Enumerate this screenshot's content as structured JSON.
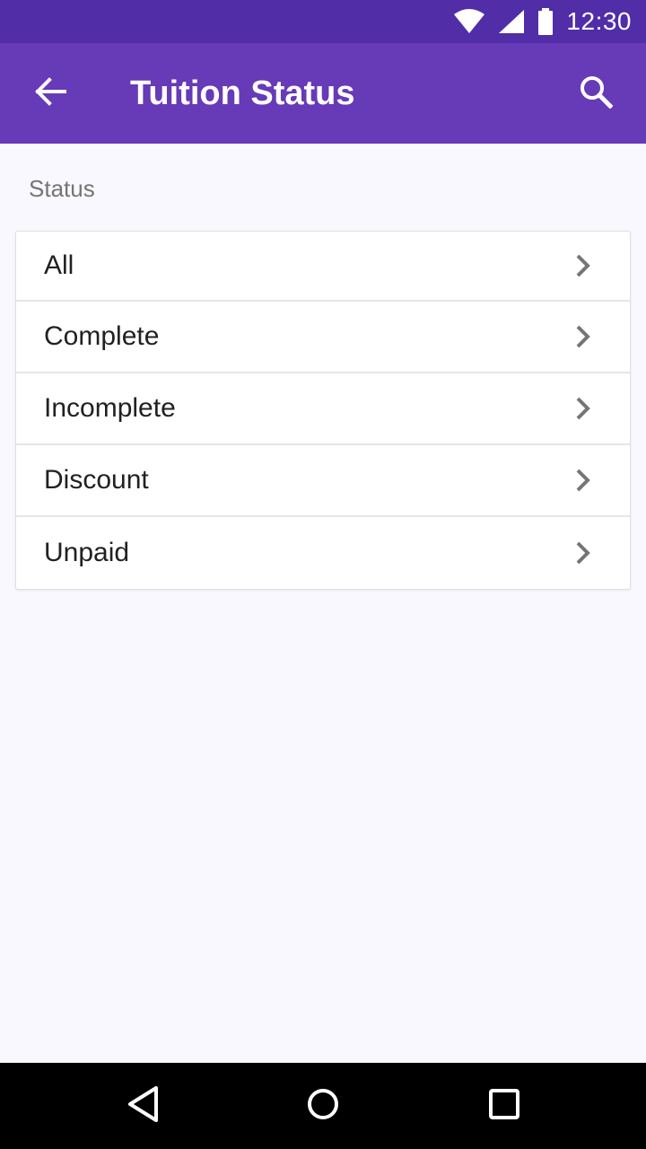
{
  "status_bar": {
    "time": "12:30",
    "icons": [
      "wifi-icon",
      "cell-signal-icon",
      "battery-icon"
    ]
  },
  "app_bar": {
    "title": "Tuition Status",
    "back_icon": "arrow-left-icon",
    "search_icon": "search-icon",
    "color": "#673ab7",
    "status_bar_color": "#512da8"
  },
  "section": {
    "header": "Status"
  },
  "status_list": {
    "items": [
      {
        "label": "All"
      },
      {
        "label": "Complete"
      },
      {
        "label": "Incomplete"
      },
      {
        "label": "Discount"
      },
      {
        "label": "Unpaid"
      }
    ],
    "trailing_icon": "chevron-right-icon"
  },
  "nav_bar": {
    "buttons": [
      "back-triangle-icon",
      "home-circle-icon",
      "recents-square-icon"
    ]
  }
}
